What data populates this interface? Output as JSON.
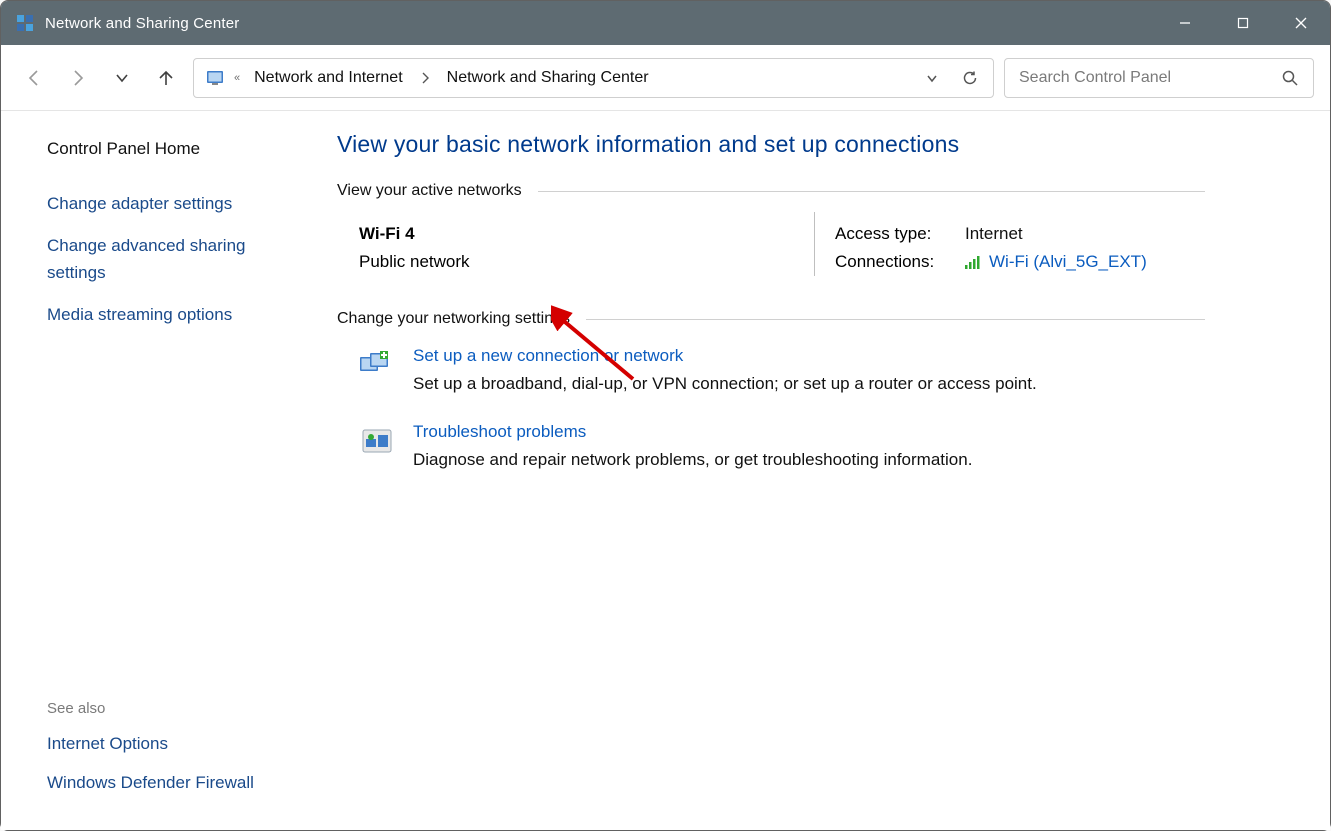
{
  "window": {
    "title": "Network and Sharing Center"
  },
  "toolbar": {
    "breadcrumbs": {
      "parent": "Network and Internet",
      "current": "Network and Sharing Center"
    },
    "search_placeholder": "Search Control Panel"
  },
  "sidebar": {
    "home": "Control Panel Home",
    "links": {
      "adapter": "Change adapter settings",
      "advanced": "Change advanced sharing settings",
      "media": "Media streaming options"
    },
    "see_also_label": "See also",
    "see_also": {
      "internet_options": "Internet Options",
      "defender": "Windows Defender Firewall"
    }
  },
  "main": {
    "heading": "View your basic network information and set up connections",
    "active_networks_label": "View your active networks",
    "network": {
      "name": "Wi-Fi 4",
      "type": "Public network",
      "access_label": "Access type:",
      "access_value": "Internet",
      "connections_label": "Connections:",
      "connection_name": "Wi-Fi (Alvi_5G_EXT)"
    },
    "change_settings_label": "Change your networking settings",
    "setup": {
      "title": "Set up a new connection or network",
      "desc": "Set up a broadband, dial-up, or VPN connection; or set up a router or access point."
    },
    "troubleshoot": {
      "title": "Troubleshoot problems",
      "desc": "Diagnose and repair network problems, or get troubleshooting information."
    }
  }
}
